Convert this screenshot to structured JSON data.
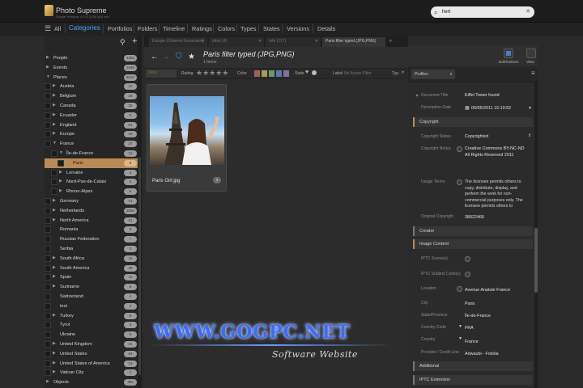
{
  "app": {
    "title": "Photo Supreme",
    "subtitle": "Single Version 4.0.0.1234 (64-bit)",
    "search_value": "hert"
  },
  "nav": {
    "all": "All",
    "items": [
      "Categories",
      "Portfolios",
      "Folders",
      "Timeline",
      "Ratings",
      "Colors",
      "Types",
      "States",
      "Versions",
      "Details"
    ]
  },
  "tree": [
    {
      "label": "People",
      "count": "4353",
      "level": 0,
      "arrow": "▶"
    },
    {
      "label": "Events",
      "count": "1048",
      "level": 0,
      "arrow": "▶"
    },
    {
      "label": "Places",
      "count": "6210",
      "level": 0,
      "arrow": "▼"
    },
    {
      "label": "Austria",
      "count": "12",
      "level": 1,
      "arrow": "▶"
    },
    {
      "label": "Belgium",
      "count": "34",
      "level": 1,
      "arrow": "▶"
    },
    {
      "label": "Canada",
      "count": "22",
      "level": 1,
      "arrow": "▶"
    },
    {
      "label": "Ecuador",
      "count": "5",
      "level": 1,
      "arrow": "▶"
    },
    {
      "label": "England",
      "count": "61",
      "level": 1,
      "arrow": "▶"
    },
    {
      "label": "Europe",
      "count": "18",
      "level": 1,
      "arrow": "▶"
    },
    {
      "label": "France",
      "count": "27",
      "level": 1,
      "arrow": "▼"
    },
    {
      "label": "Île-de-France",
      "count": "12",
      "level": 2,
      "arrow": "▼"
    },
    {
      "label": "Paris",
      "count": "8",
      "level": 3,
      "arrow": "",
      "selected": true
    },
    {
      "label": "Lorraine",
      "count": "3",
      "level": 2,
      "arrow": "▶"
    },
    {
      "label": "Nord-Pas-de-Calais",
      "count": "4",
      "level": 2,
      "arrow": "▶"
    },
    {
      "label": "Rhone-Alpes",
      "count": "6",
      "level": 2,
      "arrow": "▶"
    },
    {
      "label": "Germany",
      "count": "14",
      "level": 1,
      "arrow": "▶"
    },
    {
      "label": "Netherlands",
      "count": "2056",
      "level": 1,
      "arrow": "▶"
    },
    {
      "label": "North America",
      "count": "31",
      "level": 1,
      "arrow": "▶"
    },
    {
      "label": "Romania",
      "count": "9",
      "level": 1,
      "arrow": ""
    },
    {
      "label": "Russian Federation",
      "count": "7",
      "level": 1,
      "arrow": ""
    },
    {
      "label": "Serbia",
      "count": "3",
      "level": 1,
      "arrow": ""
    },
    {
      "label": "South Africa",
      "count": "15",
      "level": 1,
      "arrow": "▶"
    },
    {
      "label": "South America",
      "count": "40",
      "level": 1,
      "arrow": "▶"
    },
    {
      "label": "Spain",
      "count": "11",
      "level": 1,
      "arrow": "▶"
    },
    {
      "label": "Suriname",
      "count": "6",
      "level": 1,
      "arrow": "▶"
    },
    {
      "label": "Switzerland",
      "count": "4",
      "level": 1,
      "arrow": ""
    },
    {
      "label": "test",
      "count": "2",
      "level": 1,
      "arrow": ""
    },
    {
      "label": "Turkey",
      "count": "9",
      "level": 1,
      "arrow": "▶"
    },
    {
      "label": "Tyrol",
      "count": "3",
      "level": 1,
      "arrow": ""
    },
    {
      "label": "Ukraine",
      "count": "5",
      "level": 1,
      "arrow": ""
    },
    {
      "label": "United Kingdom",
      "count": "21",
      "level": 1,
      "arrow": "▶"
    },
    {
      "label": "United States",
      "count": "64",
      "level": 1,
      "arrow": "▶"
    },
    {
      "label": "United States of America",
      "count": "13",
      "level": 1,
      "arrow": "▶"
    },
    {
      "label": "Vatican City",
      "count": "2",
      "level": 1,
      "arrow": "▶"
    },
    {
      "label": "Objects",
      "count": "394",
      "level": 0,
      "arrow": "▶"
    }
  ],
  "tabs": [
    {
      "label": "Europe (Ordered Generator)"
    },
    {
      "label": "label (4)"
    },
    {
      "label": "Info (117)"
    },
    {
      "label": "Paris filter typed (JPG,PNG)"
    }
  ],
  "content": {
    "title": "Paris filter typed (JPG,PNG)",
    "subtitle": "1 Items",
    "filter": {
      "filter_label": "Filter",
      "rating_label": "Rating",
      "stars": "★★★★★",
      "color_label": "Color",
      "state_label": "State",
      "label_label": "Label",
      "label_value": "No Active Filter",
      "type_label": "Typ"
    },
    "thumb": {
      "name": "Paris Girl.jpg",
      "badge": "3"
    }
  },
  "right_toolbar": {
    "btn1": "EditToolGUI",
    "btn2": "View"
  },
  "right_panel": {
    "profiles": "Profiles",
    "document_title_label": "Document Title",
    "document_title_value": "Eiffel Tower found",
    "description_date_label": "Description Date",
    "description_date_value": "06/06/2011  15:19:52",
    "copyright_section": "Copyright",
    "copyright_status_label": "Copyright Status",
    "copyright_status_value": "Copyrighted",
    "copyright_notice_label": "Copyright Notice",
    "copyright_notice_value": "Creative Commons BY-NC-ND All Rights Reserved 2011",
    "usage_terms_label": "Usage Terms",
    "usage_terms_value": "The licensee permits others to copy, distribute, display, and perform the work for non-commercial purposes only. The licensee permits others to",
    "original_copyright_label": "Original Copyright",
    "original_copyright_value": "38022466",
    "creator_section": "Creator",
    "image_content_section": "Image Content",
    "iptc_scene_label": "IPTC Scene(s)",
    "iptc_subject_label": "IPTC Subject Code(s)",
    "location_label": "Location",
    "location_value": "Avenue Anatole France",
    "city_label": "City",
    "city_value": "Paris",
    "state_label": "State/Province",
    "state_value": "Île-de-France",
    "country_code_label": "Country Code",
    "country_code_value": "FRA",
    "country_label": "Country",
    "country_value": "France",
    "provider_label": "Provider / Credit Line",
    "provider_value": "Ariwaubi - Fotolia",
    "additional_section": "Additional",
    "iptc_ext_section": "IPTC Extension"
  },
  "watermark": {
    "main": "WWW.GOGPC.NET",
    "sub": "Software Website"
  },
  "colors": {
    "accent": "#4aa3ff",
    "selection": "#b88a55",
    "filter_icon": "#3aa0ff"
  }
}
